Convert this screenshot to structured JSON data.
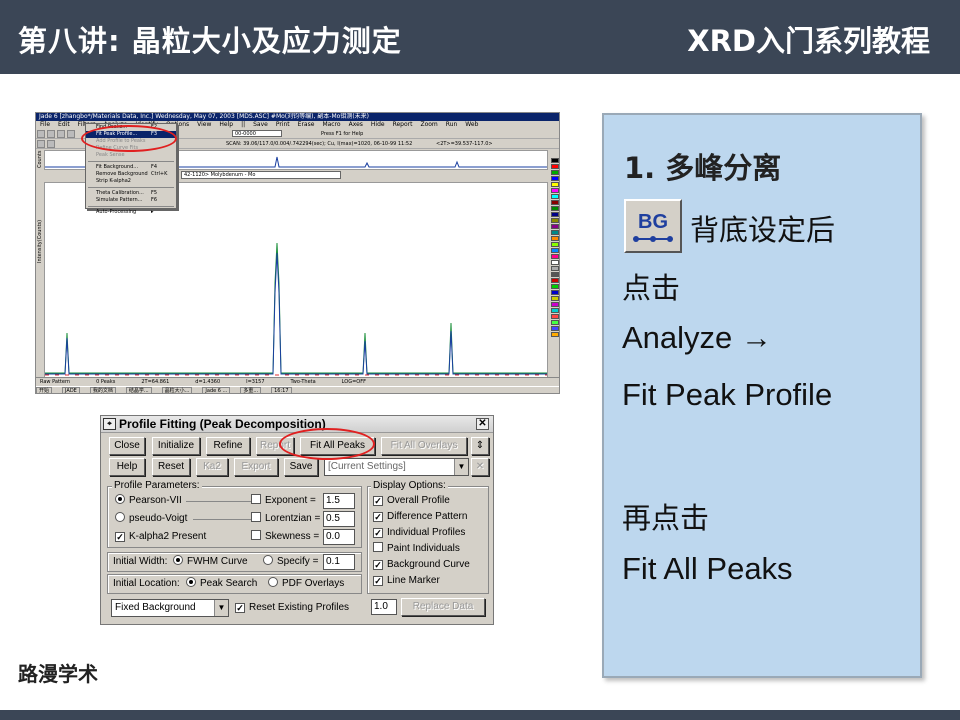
{
  "header": {
    "title": "第八讲: 晶粒大小及应力测定",
    "series": "XRD入门系列教程"
  },
  "footer": {
    "brand": "路漫学术"
  },
  "jade": {
    "title": "Jade 6 [zhangbo*/Materials Data, Inc.] Wednesday, May 07, 2003 [MDS.ASC] #Mo(刘钧等编), 副本-Mo钼测(未来)",
    "menubar": [
      "File",
      "Edit",
      "Filters",
      "Analyze",
      "Identify",
      "Options",
      "View",
      "Help",
      "||",
      "Save",
      "Print",
      "Erase",
      "Macro",
      "Axes",
      "Hide",
      "Report",
      "Zoom",
      "Run",
      "Web"
    ],
    "toolbar_field": "00-0000",
    "press_hint": "Press F1 for Help",
    "scan_info": "SCAN: 39.06/117.0/0.004/.742294(sec); Cu, I(max)=1020, 06-10-99 11:52",
    "two_theta": "<2T>=39.537-117.0>",
    "molybdenum": "42-1120> Molybdenum - Mo",
    "ylabel": "Intensity(Counts)",
    "counts": "Counts",
    "menu": [
      {
        "label": "Find Peaks...",
        "shortcut": "F2",
        "state": "normal"
      },
      {
        "label": "Fit Peak Profile...",
        "shortcut": "F3",
        "state": "selected"
      },
      {
        "label": "Add Profile to Peaks",
        "shortcut": "",
        "state": "disabled"
      },
      {
        "label": "Refine Curve Fits",
        "shortcut": "",
        "state": "disabled"
      },
      {
        "label": "Peak Sense",
        "shortcut": "",
        "state": "disabled"
      },
      {
        "label": "Fit Background...",
        "shortcut": "F4",
        "state": "normal"
      },
      {
        "label": "Remove Background",
        "shortcut": "Ctrl+K",
        "state": "normal"
      },
      {
        "label": "Strip K-alpha2",
        "shortcut": "",
        "state": "normal"
      },
      {
        "label": "Theta Calibration...",
        "shortcut": "F5",
        "state": "normal"
      },
      {
        "label": "Simulate Pattern...",
        "shortcut": "F6",
        "state": "normal"
      },
      {
        "label": "Auto-Processing",
        "shortcut": "▸",
        "state": "normal"
      }
    ],
    "status": [
      "Raw Pattern",
      "0 Peaks",
      "2T=64.861",
      "d=1.4360",
      "I=3157",
      "Two-Theta",
      "LOG=OFF"
    ],
    "taskbar": [
      "开始",
      "JADE",
      "我的文档",
      "结晶学...",
      "晶粒大小...",
      "Jade 6 ...",
      "多重...",
      "16:17"
    ],
    "palette": [
      "#000000",
      "#ff0000",
      "#00aa00",
      "#0000ff",
      "#ffff00",
      "#ff00ff",
      "#00ffff",
      "#880000",
      "#008800",
      "#000088",
      "#888800",
      "#880088",
      "#008888",
      "#ff8800",
      "#88ff00",
      "#0088ff",
      "#ff0088",
      "#ffffff",
      "#aaaaaa",
      "#555555",
      "#cc0000",
      "#00cc00",
      "#0000cc",
      "#cccc00",
      "#cc00cc",
      "#00cccc",
      "#ff4444",
      "#44ff44",
      "#4444ff",
      "#ffaa00"
    ]
  },
  "profile_fitting": {
    "title": "Profile Fitting (Peak Decomposition)",
    "buttons_row1": [
      "Close",
      "Initialize",
      "Refine",
      "Report",
      "Fit All Peaks",
      "Fit All Overlays"
    ],
    "buttons_row2": [
      "Help",
      "Reset",
      "Ka2",
      "Export",
      "Save"
    ],
    "settings_combo": "[Current Settings]",
    "profile_params_label": "Profile Parameters:",
    "pearson": "Pearson-VII",
    "pseudo_voigt": "pseudo-Voigt",
    "kalpha2": "K-alpha2 Present",
    "exponent_label": "Exponent =",
    "exponent_value": "1.5",
    "lorentzian_label": "Lorentzian =",
    "lorentzian_value": "0.5",
    "skewness_label": "Skewness =",
    "skewness_value": "0.0",
    "initial_width_label": "Initial Width:",
    "fwhm_curve": "FWHM Curve",
    "specify_label": "Specify =",
    "specify_value": "0.1",
    "initial_location_label": "Initial Location:",
    "peak_search": "Peak Search",
    "pdf_overlays": "PDF Overlays",
    "background_select": "Fixed Background",
    "reset_profiles": "Reset Existing Profiles",
    "display_options_label": "Display Options:",
    "display_options": [
      {
        "label": "Overall Profile",
        "checked": true
      },
      {
        "label": "Difference Pattern",
        "checked": true
      },
      {
        "label": "Individual Profiles",
        "checked": true
      },
      {
        "label": "Paint Individuals",
        "checked": false
      },
      {
        "label": "Background Curve",
        "checked": true
      },
      {
        "label": "Line Marker",
        "checked": true
      }
    ],
    "replace_value": "1.0",
    "replace_data": "Replace Data"
  },
  "panel": {
    "heading": "1. 多峰分离",
    "bg_icon_text": "BG",
    "line1": "背底设定后",
    "line2": "点击",
    "line3": "Analyze →",
    "line4": "Fit Peak Profile",
    "line5": "再点击",
    "line6": "Fit All Peaks"
  }
}
